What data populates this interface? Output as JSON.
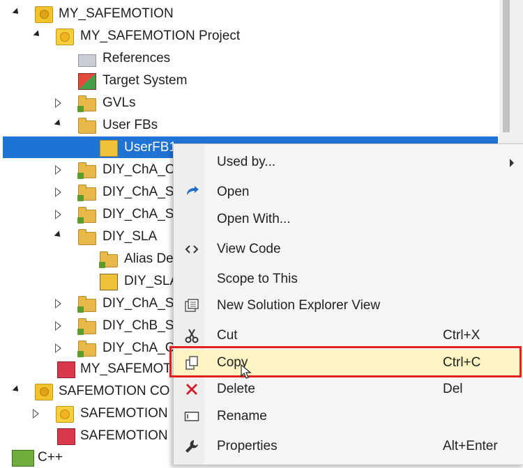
{
  "tree": {
    "rows": [
      {
        "label": "MY_SAFEMOTION",
        "expanded": true,
        "icon": "project-icon"
      },
      {
        "label": "MY_SAFEMOTION Project",
        "expanded": true,
        "icon": "safety-project-icon"
      },
      {
        "label": "References",
        "icon": "references-icon"
      },
      {
        "label": "Target System",
        "icon": "target-system-icon"
      },
      {
        "label": "GVLs",
        "expanded": false,
        "icon": "folder-icon"
      },
      {
        "label": "User FBs",
        "expanded": true,
        "icon": "folder-open-icon"
      },
      {
        "label": "UserFB1",
        "selected": true,
        "icon": "function-block-icon"
      },
      {
        "label": "DIY_ChA_C",
        "expanded": false,
        "icon": "folder-icon"
      },
      {
        "label": "DIY_ChA_S",
        "expanded": false,
        "icon": "folder-icon"
      },
      {
        "label": "DIY_ChA_S",
        "expanded": false,
        "icon": "folder-icon"
      },
      {
        "label": "DIY_SLA",
        "expanded": true,
        "icon": "folder-open-icon"
      },
      {
        "label": "Alias De",
        "icon": "alias-devices-icon"
      },
      {
        "label": "DIY_SLA",
        "icon": "safety-program-icon"
      },
      {
        "label": "DIY_ChA_S",
        "expanded": false,
        "icon": "folder-icon"
      },
      {
        "label": "DIY_ChB_S",
        "expanded": false,
        "icon": "folder-icon"
      },
      {
        "label": "DIY_ChA_C",
        "expanded": false,
        "icon": "folder-icon"
      },
      {
        "label": "MY_SAFEMOT",
        "icon": "safety-config-icon"
      },
      {
        "label": "SAFEMOTION CO",
        "expanded": true,
        "icon": "project-icon"
      },
      {
        "label": "SAFEMOTION",
        "expanded": false,
        "icon": "safety-project-icon"
      },
      {
        "label": "SAFEMOTION",
        "icon": "safety-config-icon"
      },
      {
        "label": "C++",
        "icon": "cpp-icon"
      }
    ]
  },
  "context_menu": {
    "items": [
      {
        "label": "Used by...",
        "icon": "",
        "shortcut": "",
        "submenu": true
      },
      {
        "label": "Open",
        "icon": "open-icon",
        "shortcut": ""
      },
      {
        "label": "Open With...",
        "icon": "",
        "shortcut": ""
      },
      {
        "label": "View Code",
        "icon": "view-code-icon",
        "shortcut": ""
      },
      {
        "label": "Scope to This",
        "icon": "",
        "shortcut": ""
      },
      {
        "label": "New Solution Explorer View",
        "icon": "new-explorer-view-icon",
        "shortcut": ""
      },
      {
        "label": "Cut",
        "icon": "cut-icon",
        "shortcut": "Ctrl+X"
      },
      {
        "label": "Copy",
        "icon": "copy-icon",
        "shortcut": "Ctrl+C",
        "highlighted": true
      },
      {
        "label": "Delete",
        "icon": "delete-icon",
        "shortcut": "Del"
      },
      {
        "label": "Rename",
        "icon": "rename-icon",
        "shortcut": ""
      },
      {
        "label": "Properties",
        "icon": "properties-icon",
        "shortcut": "Alt+Enter"
      }
    ]
  },
  "colors": {
    "selection": "#1f73d4",
    "highlight_box": "#e2211c",
    "menu_hover": "#fdf4c4"
  }
}
